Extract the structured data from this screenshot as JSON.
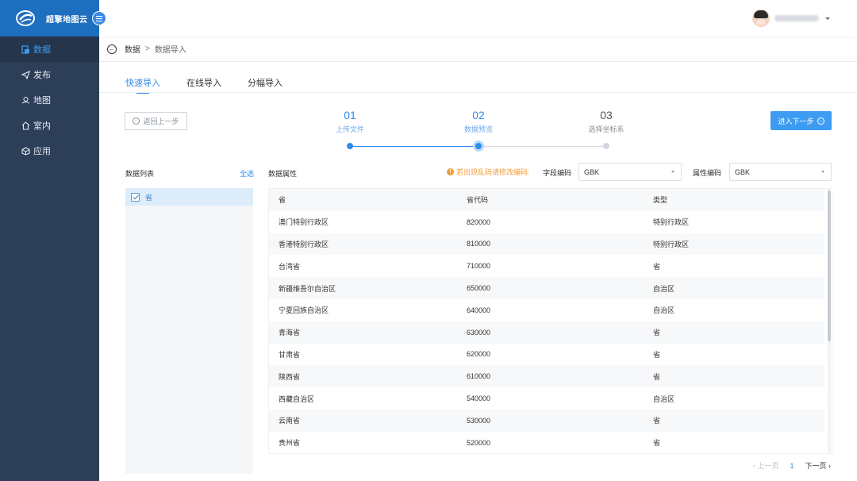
{
  "app": {
    "logo_text": "超擎地图云",
    "colors": {
      "sidebar": "#2c3e58",
      "accent": "#2e8cf0",
      "warning": "#f39c3a"
    }
  },
  "sidebar": {
    "items": [
      {
        "label": "数据",
        "icon": "data-icon",
        "active": true
      },
      {
        "label": "发布",
        "icon": "publish-icon",
        "active": false
      },
      {
        "label": "地图",
        "icon": "map-icon",
        "active": false
      },
      {
        "label": "室内",
        "icon": "indoor-icon",
        "active": false
      },
      {
        "label": "应用",
        "icon": "app-icon",
        "active": false
      }
    ]
  },
  "breadcrumb": {
    "root": "数据",
    "separator": ">",
    "current": "数据导入"
  },
  "tabs": [
    {
      "label": "快速导入",
      "active": true
    },
    {
      "label": "在线导入",
      "active": false
    },
    {
      "label": "分幅导入",
      "active": false
    }
  ],
  "stepper": {
    "prev_label": "返回上一步",
    "next_label": "进入下一步",
    "steps": [
      {
        "num": "01",
        "label": "上传文件",
        "state": "done"
      },
      {
        "num": "02",
        "label": "数据预览",
        "state": "current"
      },
      {
        "num": "03",
        "label": "选择坐标系",
        "state": "todo"
      }
    ]
  },
  "data_list": {
    "title": "数据列表",
    "select_all": "全选",
    "items": [
      {
        "label": "省",
        "checked": true
      }
    ]
  },
  "attributes": {
    "title": "数据属性",
    "warning": "若出现乱码请修改编码:",
    "field_encoding_label": "字段编码",
    "field_encoding_value": "GBK",
    "attr_encoding_label": "属性编码",
    "attr_encoding_value": "GBK"
  },
  "table": {
    "headers": [
      "省",
      "省代码",
      "类型"
    ],
    "rows": [
      [
        "澳门特别行政区",
        "820000",
        "特别行政区"
      ],
      [
        "香港特别行政区",
        "810000",
        "特别行政区"
      ],
      [
        "台湾省",
        "710000",
        "省"
      ],
      [
        "新疆维吾尔自治区",
        "650000",
        "自治区"
      ],
      [
        "宁夏回族自治区",
        "640000",
        "自治区"
      ],
      [
        "青海省",
        "630000",
        "省"
      ],
      [
        "甘肃省",
        "620000",
        "省"
      ],
      [
        "陕西省",
        "610000",
        "省"
      ],
      [
        "西藏自治区",
        "540000",
        "自治区"
      ],
      [
        "云南省",
        "530000",
        "省"
      ],
      [
        "贵州省",
        "520000",
        "省"
      ]
    ]
  },
  "pager": {
    "prev": "上一页",
    "current": "1",
    "next": "下一页"
  }
}
